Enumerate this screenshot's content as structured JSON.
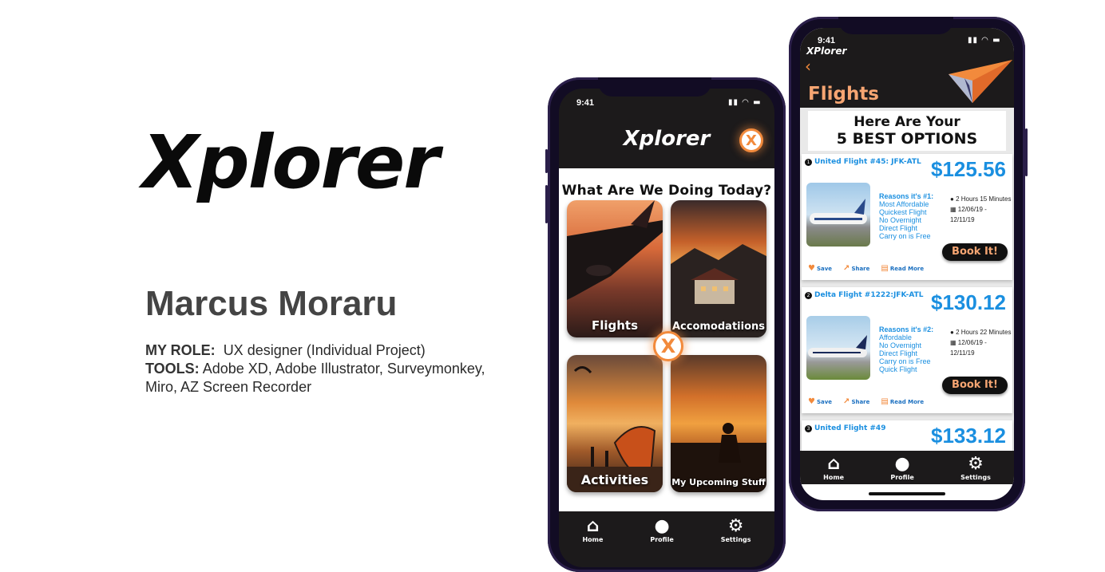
{
  "intro": {
    "brand": "Xplorer",
    "author": "Marcus Moraru",
    "role_label": "MY ROLE:",
    "role_value": "UX designer (Individual Project)",
    "tools_label": "TOOLS:",
    "tools_value": "Adobe XD, Adobe Illustrator, Surveymonkey,",
    "tools_value2": "Miro, AZ Screen Recorder"
  },
  "phone1": {
    "time": "9:41",
    "title": "Xplorer",
    "close_glyph": "X",
    "question": "What Are We Doing Today?",
    "tiles": [
      {
        "label": "Flights"
      },
      {
        "label": "Accomodatiions"
      },
      {
        "label": "Activities"
      },
      {
        "label": "My Upcoming Stuff"
      }
    ],
    "tabs": [
      {
        "label": "Home",
        "icon": "home-icon"
      },
      {
        "label": "Profile",
        "icon": "profile-icon"
      },
      {
        "label": "Settings",
        "icon": "gear-icon"
      }
    ]
  },
  "phone2": {
    "time": "9:41",
    "app_name": "XPlorer",
    "title": "Flights",
    "banner_line1": "Here Are Your",
    "banner_line2": "5 BEST OPTIONS",
    "flights": [
      {
        "num": "1",
        "name": "United Flight #45: JFK-ATL",
        "price": "$125.56",
        "reasons_title": "Reasons it's #1:",
        "reasons": [
          "Most Affordable",
          "Quickest Flight",
          "No Overnight",
          "Direct Flight",
          "Carry on is Free"
        ],
        "duration": "2 Hours 15 Minutes",
        "dates": "12/06/19 - 12/11/19",
        "book": "Book It!"
      },
      {
        "num": "2",
        "name": "Delta Flight #1222:JFK-ATL",
        "price": "$130.12",
        "reasons_title": "Reasons it's #2:",
        "reasons": [
          "Affordable",
          "No Overnight",
          "Direct Flight",
          "Carry on is Free",
          "Quick Flight"
        ],
        "duration": "2 Hours 22 Minutes",
        "dates": "12/06/19 - 12/11/19",
        "book": "Book It!"
      },
      {
        "num": "3",
        "name": "United Flight #49",
        "price": "$133.12"
      }
    ],
    "actions": {
      "save": "Save",
      "share": "Share",
      "read_more": "Read More"
    },
    "tabs": [
      {
        "label": "Home",
        "icon": "home-icon"
      },
      {
        "label": "Profile",
        "icon": "profile-icon"
      },
      {
        "label": "Settings",
        "icon": "gear-icon"
      }
    ]
  },
  "colors": {
    "accent": "#f28a3c",
    "link_blue": "#1a8fe0",
    "dark": "#1c1a1b"
  }
}
